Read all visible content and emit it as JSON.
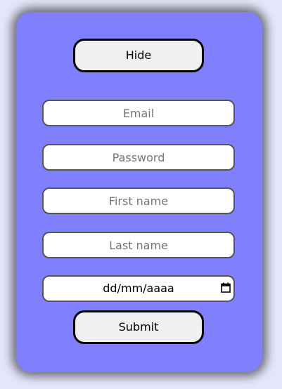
{
  "form": {
    "hide_label": "Hide",
    "submit_label": "Submit",
    "email": {
      "placeholder": "Email",
      "value": ""
    },
    "password": {
      "placeholder": "Password",
      "value": ""
    },
    "first_name": {
      "placeholder": "First name",
      "value": ""
    },
    "last_name": {
      "placeholder": "Last name",
      "value": ""
    },
    "birthdate": {
      "display": "dd/mm/aaaa",
      "icon": "calendar-icon"
    }
  },
  "colors": {
    "background": "#e6e6fb",
    "card": "#8080ff",
    "button": "#f0f0f0",
    "field": "#ffffff"
  }
}
